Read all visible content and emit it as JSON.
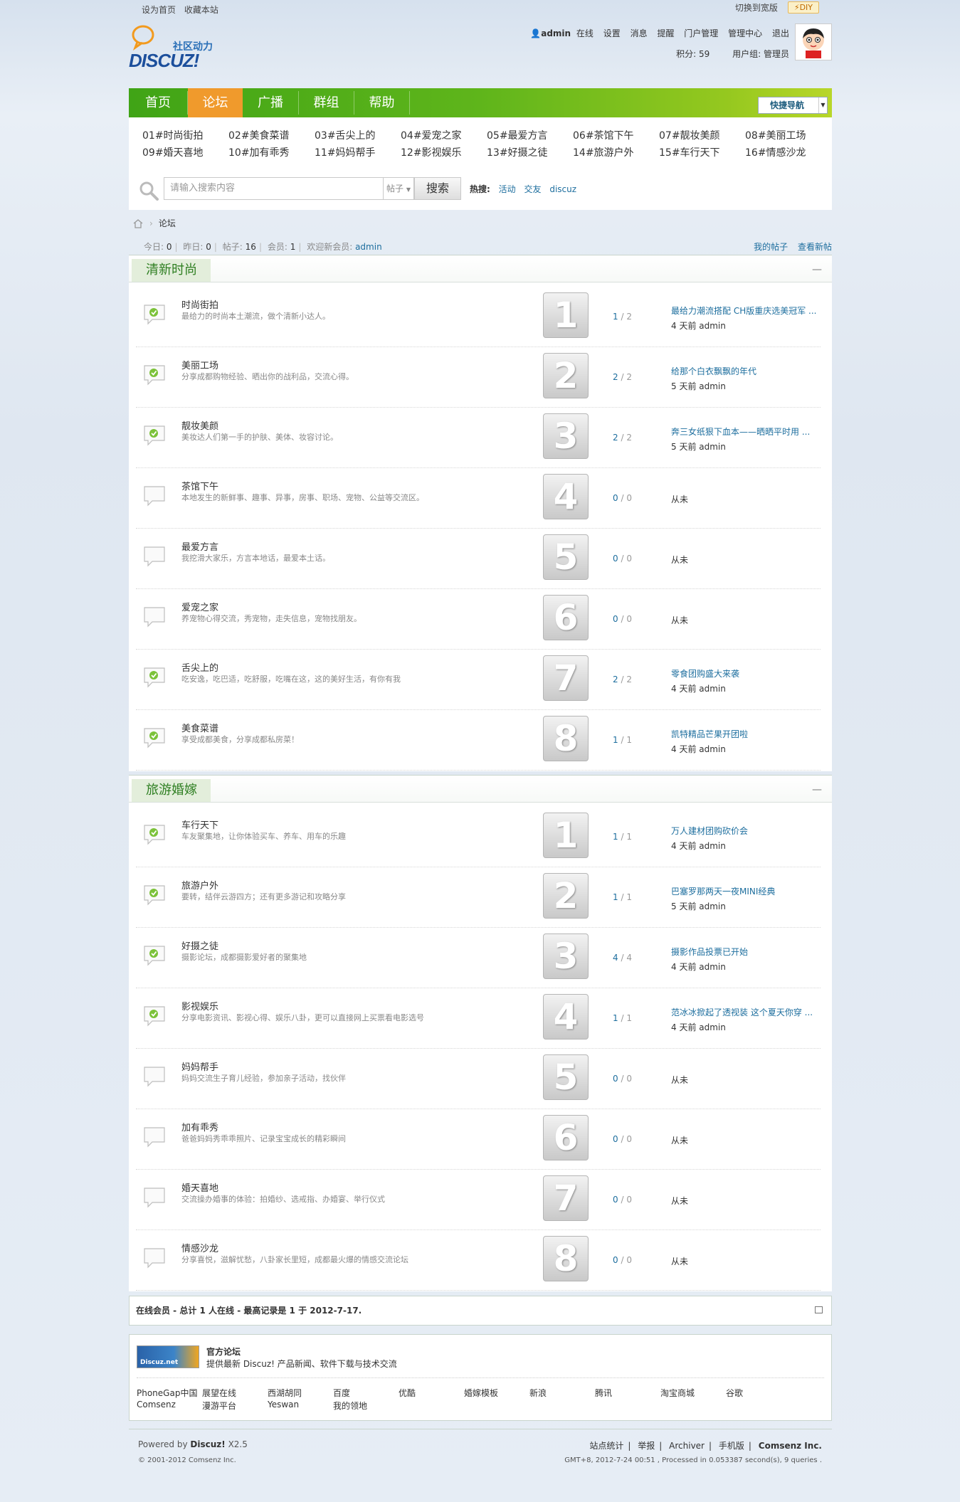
{
  "topbar": {
    "set_home": "设为首页",
    "bookmark": "收藏本站",
    "widescreen": "切换到宽版",
    "diy": "DIY"
  },
  "logo": {
    "tagline": "社区动力",
    "brand": "DISCUZ!"
  },
  "user": {
    "name": "admin",
    "status": "在线",
    "links": [
      "设置",
      "消息",
      "提醒",
      "门户管理",
      "管理中心",
      "退出"
    ],
    "points_label": "积分: 59",
    "group_label": "用户组: 管理员"
  },
  "nav": {
    "items": [
      "首页",
      "论坛",
      "广播",
      "群组",
      "帮助"
    ],
    "active": 1,
    "quicknav": "快捷导航"
  },
  "sublinks": [
    "01#时尚街拍",
    "02#美食菜谱",
    "03#舌尖上的",
    "04#爱宠之家",
    "05#最爱方言",
    "06#茶馆下午",
    "07#靓妆美颜",
    "08#美丽工场",
    "09#婚天喜地",
    "10#加有乖秀",
    "11#妈妈帮手",
    "12#影视娱乐",
    "13#好摄之徒",
    "14#旅游户外",
    "15#车行天下",
    "16#情感沙龙"
  ],
  "search": {
    "placeholder": "请输入搜索内容",
    "type": "帖子",
    "button": "搜索",
    "hot_label": "热搜:",
    "hot": [
      "活动",
      "交友",
      "discuz"
    ]
  },
  "crumb": {
    "current": "论坛"
  },
  "stats": {
    "today_label": "今日:",
    "today": "0",
    "yesterday_label": "昨日:",
    "yesterday": "0",
    "posts_label": "帖子:",
    "posts": "16",
    "members_label": "会员:",
    "members": "1",
    "welcome_label": "欢迎新会员:",
    "welcome": "admin",
    "my_posts": "我的帖子",
    "new_posts": "查看新帖"
  },
  "sections": [
    {
      "title": "清新时尚",
      "collapse": "—",
      "forums": [
        {
          "name": "时尚街拍",
          "desc": "最给力的时尚本土潮流，做个清新小达人。",
          "num": "1",
          "threads": "1",
          "posts": "2",
          "new": true,
          "last_title": "最给力潮流搭配 CH版重庆选美冠军 ...",
          "last_meta": "4 天前 admin"
        },
        {
          "name": "美丽工场",
          "desc": "分享成都购物经验、晒出你的战利品，交流心得。",
          "num": "2",
          "threads": "2",
          "posts": "2",
          "new": true,
          "last_title": "给那个白衣飘飘的年代",
          "last_meta": "5 天前 admin"
        },
        {
          "name": "靓妆美颜",
          "desc": "美妆达人们第一手的护肤、美体、妆容讨论。",
          "num": "3",
          "threads": "2",
          "posts": "2",
          "new": true,
          "last_title": "奔三女纸狠下血本——晒晒平时用 ...",
          "last_meta": "5 天前 admin"
        },
        {
          "name": "茶馆下午",
          "desc": "本地发生的新鲜事、趣事、异事，房事、职场、宠物、公益等交流区。",
          "num": "4",
          "threads": "0",
          "posts": "0",
          "new": false,
          "last_title": "",
          "last_meta": "从未"
        },
        {
          "name": "最爱方言",
          "desc": "我挖滑大家乐，方言本地话，最爱本土话。",
          "num": "5",
          "threads": "0",
          "posts": "0",
          "new": false,
          "last_title": "",
          "last_meta": "从未"
        },
        {
          "name": "爱宠之家",
          "desc": "养宠物心得交流，秀宠物，走失信息，宠物找朋友。",
          "num": "6",
          "threads": "0",
          "posts": "0",
          "new": false,
          "last_title": "",
          "last_meta": "从未"
        },
        {
          "name": "舌尖上的",
          "desc": "吃安逸，吃巴适，吃舒服，吃嘴在这，这的美好生活，有你有我",
          "num": "7",
          "threads": "2",
          "posts": "2",
          "new": true,
          "last_title": "零食团购盛大来袭",
          "last_meta": "4 天前 admin"
        },
        {
          "name": "美食菜谱",
          "desc": "享受成都美食，分享成都私房菜！",
          "num": "8",
          "threads": "1",
          "posts": "1",
          "new": true,
          "last_title": "凯特精品芒果开团啦",
          "last_meta": "4 天前 admin"
        }
      ]
    },
    {
      "title": "旅游婚嫁",
      "collapse": "—",
      "forums": [
        {
          "name": "车行天下",
          "desc": "车友聚集地，让你体验买车、养车、用车的乐趣",
          "num": "1",
          "threads": "1",
          "posts": "1",
          "new": true,
          "last_title": "万人建材团购砍价会",
          "last_meta": "4 天前 admin"
        },
        {
          "name": "旅游户外",
          "desc": "要转，结伴云游四方；还有更多游记和攻略分享",
          "num": "2",
          "threads": "1",
          "posts": "1",
          "new": true,
          "last_title": "巴塞罗那两天一夜MINI经典",
          "last_meta": "5 天前 admin"
        },
        {
          "name": "好摄之徒",
          "desc": "摄影论坛，成都摄影爱好者的聚集地",
          "num": "3",
          "threads": "4",
          "posts": "4",
          "new": true,
          "last_title": "摄影作品投票已开始",
          "last_meta": "4 天前 admin"
        },
        {
          "name": "影视娱乐",
          "desc": "分享电影资讯、影视心得、娱乐八卦，更可以直接网上买票看电影选号",
          "num": "4",
          "threads": "1",
          "posts": "1",
          "new": true,
          "last_title": "范冰冰掀起了透视装 这个夏天你穿 ...",
          "last_meta": "4 天前 admin"
        },
        {
          "name": "妈妈帮手",
          "desc": "妈妈交流生子育儿经验，参加亲子活动，找伙伴",
          "num": "5",
          "threads": "0",
          "posts": "0",
          "new": false,
          "last_title": "",
          "last_meta": "从未"
        },
        {
          "name": "加有乖秀",
          "desc": "爸爸妈妈秀乖乖照片、记录宝宝成长的精彩瞬间",
          "num": "6",
          "threads": "0",
          "posts": "0",
          "new": false,
          "last_title": "",
          "last_meta": "从未"
        },
        {
          "name": "婚天喜地",
          "desc": "交流操办婚事的体验：拍婚纱、选戒指、办婚宴、举行仪式",
          "num": "7",
          "threads": "0",
          "posts": "0",
          "new": false,
          "last_title": "",
          "last_meta": "从未"
        },
        {
          "name": "情感沙龙",
          "desc": "分享喜悦，滋解忧愁，八卦家长里短，成都最火爆的情感交流论坛",
          "num": "8",
          "threads": "0",
          "posts": "0",
          "new": false,
          "last_title": "",
          "last_meta": "从未"
        }
      ]
    }
  ],
  "online": {
    "text": "在线会员 - 总计 1 人在线 - 最高记录是 1 于 2012-7-17."
  },
  "links": {
    "logo_text": "Discuz.net",
    "official_title": "官方论坛",
    "official_desc": "提供最新 Discuz! 产品新闻、软件下载与技术交流",
    "row1": [
      "PhoneGap中国",
      "展望在线",
      "西湖胡同",
      "百度",
      "优酷",
      "婚嫁模板",
      "新浪",
      "腾讯",
      "淘宝商城",
      "谷歌"
    ],
    "row2": [
      "Comsenz",
      "漫游平台",
      "Yeswan",
      "我的领地"
    ]
  },
  "footer": {
    "powered_label": "Powered by",
    "powered_name": "Discuz!",
    "version": "X2.5",
    "copyright": "© 2001-2012 Comsenz Inc.",
    "links": [
      "站点统计",
      "举报",
      "Archiver",
      "手机版"
    ],
    "company": "Comsenz Inc.",
    "info": "GMT+8, 2012-7-24 00:51 , Processed in 0.053387 second(s), 9 queries ."
  },
  "colors": {
    "nav_green": "#40a416",
    "nav_active": "#f09a2c",
    "link": "#1d6e9e",
    "section_title": "#2f7f22"
  }
}
